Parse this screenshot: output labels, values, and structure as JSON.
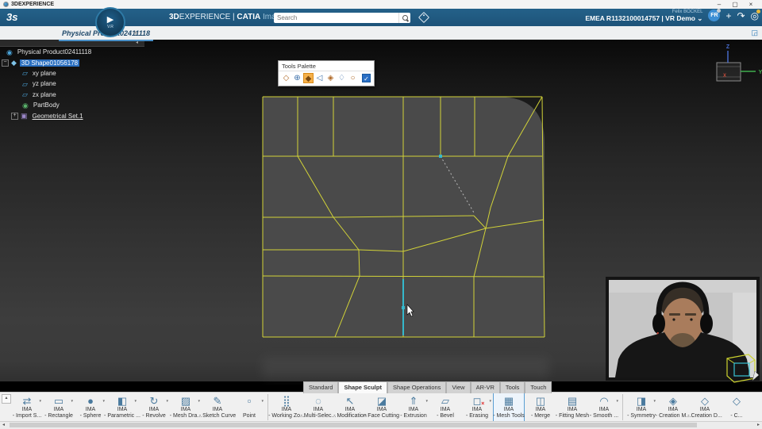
{
  "window": {
    "title": "3DEXPERIENCE",
    "minimize": "–",
    "maximize": "▢",
    "close": "×"
  },
  "topbar": {
    "logo": "3s",
    "brand_bold": "3D",
    "brand_light": "EXPERIENCE",
    "divider": " | ",
    "app_bold": "CATIA",
    "app_light": " Imagine & Shape",
    "badge_play": "▶",
    "badge_vr": "V.R",
    "search_placeholder": "Search",
    "user_name": "Felix BOCKEL",
    "environment": "EMEA R1132100014757 | VR Demo ⌄",
    "avatar_initials": "FR",
    "add_icon": "+",
    "share_icon": "↷",
    "help_icon": "◎"
  },
  "tabbar": {
    "active_tab": "Physical Product02411118",
    "add_tab": "+",
    "expand_icon": "◲"
  },
  "tree": {
    "collapse_arrow": "◂",
    "icon_glyphs": {
      "product": "◉",
      "shape": "◆",
      "plane": "▱",
      "partbody": "◉",
      "geoset": "▣"
    },
    "items": [
      {
        "label": "Physical Product02411118",
        "icon": "product",
        "depth": 0
      },
      {
        "label": "3D Shape01056178",
        "icon": "shape",
        "depth": 0,
        "expander": "−",
        "selected": true
      },
      {
        "label": "xy plane",
        "icon": "plane",
        "depth": 1
      },
      {
        "label": "yz plane",
        "icon": "plane",
        "depth": 1
      },
      {
        "label": "zx plane",
        "icon": "plane",
        "depth": 1
      },
      {
        "label": "PartBody",
        "icon": "partbody",
        "depth": 1
      },
      {
        "label": "Geometrical Set.1",
        "icon": "geoset",
        "depth": 1,
        "expander": "+",
        "underline": true
      }
    ]
  },
  "tools_palette": {
    "title": "Tools Palette",
    "icons": [
      "◇",
      "⊕",
      "◆",
      "◁",
      "◈",
      "♢",
      "○"
    ],
    "active_index": 2,
    "checkbox_checked": true,
    "check_glyph": "✓"
  },
  "viewport": {
    "triad": {
      "x_label": "X",
      "y_label": "Y",
      "z_label": "Z",
      "x_color": "#c84b3a",
      "y_color": "#3fae4e",
      "z_color": "#4a6fd4"
    },
    "mesh": {
      "surface_fill": "#4a4a4a",
      "stroke": "#d2d338",
      "dashed_color": "#b8b8b8",
      "highlight_color": "#35b8cc",
      "yellow_lines": [
        [
          [
            331,
            122
          ],
          [
            683,
            122
          ]
        ],
        [
          [
            331,
            122
          ],
          [
            331,
            425
          ]
        ],
        [
          [
            683,
            122
          ],
          [
            686,
            425
          ]
        ],
        [
          [
            331,
            425
          ],
          [
            686,
            425
          ]
        ],
        [
          [
            331,
            197
          ],
          [
            683,
            197
          ]
        ],
        [
          [
            331,
            274
          ],
          [
            420,
            274
          ],
          [
            597,
            272
          ]
        ],
        [
          [
            597,
            272
          ],
          [
            612,
            288
          ],
          [
            685,
            277
          ]
        ],
        [
          [
            331,
            315
          ],
          [
            452,
            315
          ],
          [
            508,
            317
          ]
        ],
        [
          [
            508,
            317
          ],
          [
            612,
            288
          ]
        ],
        [
          [
            331,
            348
          ],
          [
            685,
            349
          ]
        ],
        [
          [
            375,
            122
          ],
          [
            375,
            197
          ],
          [
            420,
            274
          ],
          [
            452,
            315
          ],
          [
            453,
            348
          ],
          [
            422,
            425
          ]
        ],
        [
          [
            420,
            122
          ],
          [
            420,
            197
          ]
        ],
        [
          [
            508,
            122
          ],
          [
            508,
            425
          ]
        ],
        [
          [
            555,
            122
          ],
          [
            555,
            197
          ]
        ],
        [
          [
            598,
            122
          ],
          [
            598,
            197
          ]
        ],
        [
          [
            683,
            122
          ],
          [
            648,
            183
          ],
          [
            640,
            197
          ],
          [
            618,
            262
          ],
          [
            612,
            288
          ]
        ],
        [
          [
            612,
            288
          ],
          [
            597,
            349
          ],
          [
            597,
            425
          ]
        ]
      ],
      "dashed_line": [
        [
          555,
          197
        ],
        [
          597,
          268
        ]
      ],
      "highlight_line": [
        [
          508,
          352
        ],
        [
          508,
          423
        ]
      ],
      "highlight_points": [
        [
          508,
          388
        ],
        [
          555,
          197
        ]
      ]
    },
    "widget_colors": {
      "outer": "#cdd32f",
      "inner": "#38c4d4"
    }
  },
  "action_bar": {
    "collapse_chevron": "▴",
    "dropdown_glyph": "▾",
    "tabs": [
      {
        "label": "Standard"
      },
      {
        "label": "Shape Sculpt",
        "active": true
      },
      {
        "label": "Shape Operations"
      },
      {
        "label": "View"
      },
      {
        "label": "AR-VR"
      },
      {
        "label": "Tools"
      },
      {
        "label": "Touch"
      }
    ],
    "icon_glyphs": {
      "import": "⇄",
      "rectangle": "▭",
      "sphere": "●",
      "parametric": "◧",
      "revolve": "↻",
      "mesh-draw": "▨",
      "sketch-curve": "✎",
      "point": "▫",
      "working-zone": "⣿",
      "multi-select": "◌",
      "modification": "↖",
      "face-cutting": "◪",
      "extrusion": "⇑",
      "bevel": "▱",
      "erasing": "◻",
      "mesh-tools": "▦",
      "merge": "◫",
      "fitting-mesh": "▤",
      "smooth": "◠",
      "symmetry": "◨",
      "creation-m": "◈",
      "creation-d": "◇"
    },
    "buttons": [
      {
        "line1": "IMA",
        "line2": "- Import S...",
        "icon": "import",
        "dropdown": true
      },
      {
        "line1": "IMA",
        "line2": "- Rectangle",
        "icon": "rectangle",
        "dropdown": true
      },
      {
        "line1": "IMA",
        "line2": "- Sphere",
        "icon": "sphere",
        "dropdown": true
      },
      {
        "line1": "IMA",
        "line2": "- Parametric ...",
        "icon": "parametric",
        "dropdown": true
      },
      {
        "line1": "IMA",
        "line2": "- Revolve",
        "icon": "revolve",
        "dropdown": true
      },
      {
        "line1": "IMA",
        "line2": "- Mesh Dra...",
        "icon": "mesh-draw",
        "dropdown": true
      },
      {
        "line1": "IMA",
        "line2": "- Sketch Curve",
        "icon": "sketch-curve"
      },
      {
        "line1": "",
        "line2": "Point",
        "icon": "point",
        "dropdown": true
      },
      {
        "separator": true
      },
      {
        "line1": "IMA",
        "line2": "- Working Zo...",
        "icon": "working-zone"
      },
      {
        "line1": "IMA",
        "line2": "- Multi-Selec...",
        "icon": "multi-select"
      },
      {
        "line1": "IMA",
        "line2": "- Modification",
        "icon": "modification"
      },
      {
        "line1": "IMA",
        "line2": "- Face Cutting",
        "icon": "face-cutting"
      },
      {
        "line1": "IMA",
        "line2": "- Extrusion",
        "icon": "extrusion",
        "dropdown": true
      },
      {
        "line1": "IMA",
        "line2": "- Bevel",
        "icon": "bevel"
      },
      {
        "line1": "IMA",
        "line2": "- Erasing",
        "icon": "erasing",
        "dropdown": true,
        "badge": "×"
      },
      {
        "line1": "IMA",
        "line2": "- Mesh Tools",
        "icon": "mesh-tools",
        "selected": true
      },
      {
        "line1": "IMA",
        "line2": "- Merge",
        "icon": "merge"
      },
      {
        "line1": "IMA",
        "line2": "- Fitting Mesh",
        "icon": "fitting-mesh"
      },
      {
        "line1": "IMA",
        "line2": "- Smooth ...",
        "icon": "smooth",
        "dropdown": true
      },
      {
        "separator": true
      },
      {
        "line1": "IMA",
        "line2": "- Symmetry",
        "icon": "symmetry",
        "dropdown": true
      },
      {
        "line1": "IMA",
        "line2": "- Creation M...",
        "icon": "creation-m"
      },
      {
        "line1": "IMA",
        "line2": "- Creation D...",
        "icon": "creation-d"
      },
      {
        "line1": "",
        "line2": "- C...",
        "icon": "creation-d",
        "partial": true
      }
    ],
    "scroll": {
      "left_arrow": "◂",
      "right_arrow": "▸"
    }
  }
}
